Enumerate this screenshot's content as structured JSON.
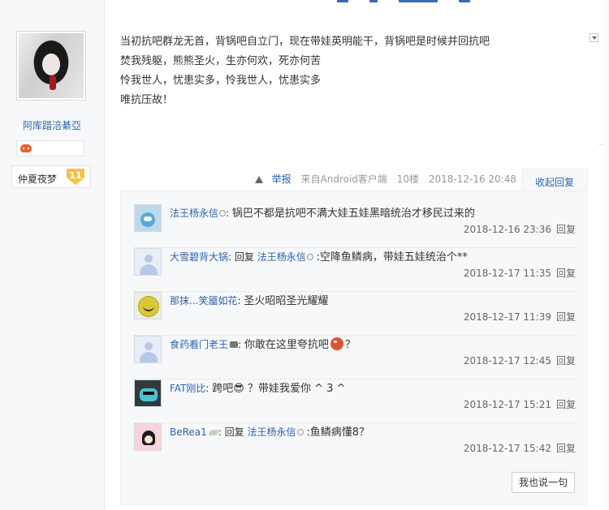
{
  "author": {
    "username": "阿库踖涪綦亞",
    "level_name": "仲夏夜梦",
    "level": "11"
  },
  "post": {
    "lines": [
      "当初抗吧群龙无首，背锅吧自立门，现在带娃英明能干，背锅吧是时候并回抗吧",
      "焚我残躯，熊熊圣火，生亦何欢，死亦何苦",
      "怜我世人，忧患实多，怜我世人，忧患实多",
      "唯抗压故！"
    ],
    "report_label": "举报",
    "source": "来自Android客户端",
    "floor": "10楼",
    "time": "2018-12-16 20:48",
    "collapse_label": "收起回复"
  },
  "replies": [
    {
      "name": "法王杨永信",
      "prefix": "",
      "reply_to": "",
      "text": "锅巴不都是抗吧不满大娃五娃黑暗统治才移民过来的",
      "time": "2018-12-16 23:36",
      "reply": "回复"
    },
    {
      "name": "大雪碧背大锅",
      "prefix": "回复 ",
      "reply_to": "法王杨永信",
      "text": ":空降鱼鳞病，带娃五娃统治个**",
      "time": "2018-12-17 11:35",
      "reply": "回复"
    },
    {
      "name": "那抹...笑靥如花",
      "prefix": "",
      "reply_to": "",
      "text": "圣火昭昭圣光耀耀",
      "time": "2018-12-17 11:39",
      "reply": "回复"
    },
    {
      "name": "食药看门老王",
      "prefix": "",
      "reply_to": "",
      "text_a": "你敢在这里夸抗吧",
      "text_b": "？",
      "time": "2018-12-17 12:45",
      "reply": "回复"
    },
    {
      "name": "FAT刚比",
      "prefix": "",
      "reply_to": "",
      "text": "跨吧😎 ？带娃我爱你 ^ 3 ^",
      "time": "2018-12-17 15:21",
      "reply": "回复"
    },
    {
      "name": "BeRea1",
      "prefix": "回复 ",
      "reply_to": "法王杨永信",
      "text": ":鱼鳞病懂8？",
      "time": "2018-12-17 15:42",
      "reply": "回复"
    }
  ],
  "say_button": "我也说一句"
}
